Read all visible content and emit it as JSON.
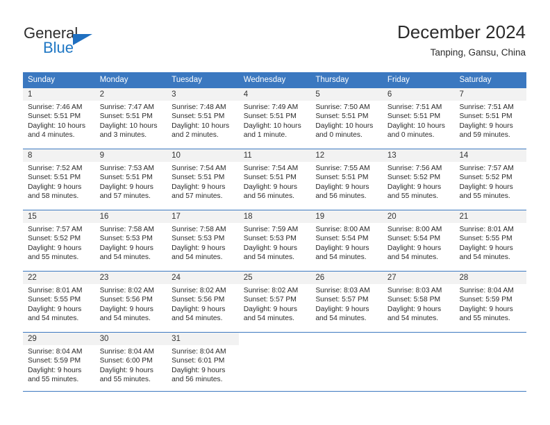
{
  "logo": {
    "line1": "General",
    "line2": "Blue",
    "triangle_icon": "triangle-icon"
  },
  "header": {
    "month_title": "December 2024",
    "location": "Tanping, Gansu, China"
  },
  "colors": {
    "header_blue": "#3b78c0",
    "logo_blue": "#1f77c4",
    "day_band": "#f2f2f2",
    "text": "#2a2a2a"
  },
  "calendar": {
    "weekday_headers": [
      "Sunday",
      "Monday",
      "Tuesday",
      "Wednesday",
      "Thursday",
      "Friday",
      "Saturday"
    ],
    "weeks": [
      [
        {
          "day": "1",
          "sunrise": "Sunrise: 7:46 AM",
          "sunset": "Sunset: 5:51 PM",
          "daylight1": "Daylight: 10 hours",
          "daylight2": "and 4 minutes."
        },
        {
          "day": "2",
          "sunrise": "Sunrise: 7:47 AM",
          "sunset": "Sunset: 5:51 PM",
          "daylight1": "Daylight: 10 hours",
          "daylight2": "and 3 minutes."
        },
        {
          "day": "3",
          "sunrise": "Sunrise: 7:48 AM",
          "sunset": "Sunset: 5:51 PM",
          "daylight1": "Daylight: 10 hours",
          "daylight2": "and 2 minutes."
        },
        {
          "day": "4",
          "sunrise": "Sunrise: 7:49 AM",
          "sunset": "Sunset: 5:51 PM",
          "daylight1": "Daylight: 10 hours",
          "daylight2": "and 1 minute."
        },
        {
          "day": "5",
          "sunrise": "Sunrise: 7:50 AM",
          "sunset": "Sunset: 5:51 PM",
          "daylight1": "Daylight: 10 hours",
          "daylight2": "and 0 minutes."
        },
        {
          "day": "6",
          "sunrise": "Sunrise: 7:51 AM",
          "sunset": "Sunset: 5:51 PM",
          "daylight1": "Daylight: 10 hours",
          "daylight2": "and 0 minutes."
        },
        {
          "day": "7",
          "sunrise": "Sunrise: 7:51 AM",
          "sunset": "Sunset: 5:51 PM",
          "daylight1": "Daylight: 9 hours",
          "daylight2": "and 59 minutes."
        }
      ],
      [
        {
          "day": "8",
          "sunrise": "Sunrise: 7:52 AM",
          "sunset": "Sunset: 5:51 PM",
          "daylight1": "Daylight: 9 hours",
          "daylight2": "and 58 minutes."
        },
        {
          "day": "9",
          "sunrise": "Sunrise: 7:53 AM",
          "sunset": "Sunset: 5:51 PM",
          "daylight1": "Daylight: 9 hours",
          "daylight2": "and 57 minutes."
        },
        {
          "day": "10",
          "sunrise": "Sunrise: 7:54 AM",
          "sunset": "Sunset: 5:51 PM",
          "daylight1": "Daylight: 9 hours",
          "daylight2": "and 57 minutes."
        },
        {
          "day": "11",
          "sunrise": "Sunrise: 7:54 AM",
          "sunset": "Sunset: 5:51 PM",
          "daylight1": "Daylight: 9 hours",
          "daylight2": "and 56 minutes."
        },
        {
          "day": "12",
          "sunrise": "Sunrise: 7:55 AM",
          "sunset": "Sunset: 5:51 PM",
          "daylight1": "Daylight: 9 hours",
          "daylight2": "and 56 minutes."
        },
        {
          "day": "13",
          "sunrise": "Sunrise: 7:56 AM",
          "sunset": "Sunset: 5:52 PM",
          "daylight1": "Daylight: 9 hours",
          "daylight2": "and 55 minutes."
        },
        {
          "day": "14",
          "sunrise": "Sunrise: 7:57 AM",
          "sunset": "Sunset: 5:52 PM",
          "daylight1": "Daylight: 9 hours",
          "daylight2": "and 55 minutes."
        }
      ],
      [
        {
          "day": "15",
          "sunrise": "Sunrise: 7:57 AM",
          "sunset": "Sunset: 5:52 PM",
          "daylight1": "Daylight: 9 hours",
          "daylight2": "and 55 minutes."
        },
        {
          "day": "16",
          "sunrise": "Sunrise: 7:58 AM",
          "sunset": "Sunset: 5:53 PM",
          "daylight1": "Daylight: 9 hours",
          "daylight2": "and 54 minutes."
        },
        {
          "day": "17",
          "sunrise": "Sunrise: 7:58 AM",
          "sunset": "Sunset: 5:53 PM",
          "daylight1": "Daylight: 9 hours",
          "daylight2": "and 54 minutes."
        },
        {
          "day": "18",
          "sunrise": "Sunrise: 7:59 AM",
          "sunset": "Sunset: 5:53 PM",
          "daylight1": "Daylight: 9 hours",
          "daylight2": "and 54 minutes."
        },
        {
          "day": "19",
          "sunrise": "Sunrise: 8:00 AM",
          "sunset": "Sunset: 5:54 PM",
          "daylight1": "Daylight: 9 hours",
          "daylight2": "and 54 minutes."
        },
        {
          "day": "20",
          "sunrise": "Sunrise: 8:00 AM",
          "sunset": "Sunset: 5:54 PM",
          "daylight1": "Daylight: 9 hours",
          "daylight2": "and 54 minutes."
        },
        {
          "day": "21",
          "sunrise": "Sunrise: 8:01 AM",
          "sunset": "Sunset: 5:55 PM",
          "daylight1": "Daylight: 9 hours",
          "daylight2": "and 54 minutes."
        }
      ],
      [
        {
          "day": "22",
          "sunrise": "Sunrise: 8:01 AM",
          "sunset": "Sunset: 5:55 PM",
          "daylight1": "Daylight: 9 hours",
          "daylight2": "and 54 minutes."
        },
        {
          "day": "23",
          "sunrise": "Sunrise: 8:02 AM",
          "sunset": "Sunset: 5:56 PM",
          "daylight1": "Daylight: 9 hours",
          "daylight2": "and 54 minutes."
        },
        {
          "day": "24",
          "sunrise": "Sunrise: 8:02 AM",
          "sunset": "Sunset: 5:56 PM",
          "daylight1": "Daylight: 9 hours",
          "daylight2": "and 54 minutes."
        },
        {
          "day": "25",
          "sunrise": "Sunrise: 8:02 AM",
          "sunset": "Sunset: 5:57 PM",
          "daylight1": "Daylight: 9 hours",
          "daylight2": "and 54 minutes."
        },
        {
          "day": "26",
          "sunrise": "Sunrise: 8:03 AM",
          "sunset": "Sunset: 5:57 PM",
          "daylight1": "Daylight: 9 hours",
          "daylight2": "and 54 minutes."
        },
        {
          "day": "27",
          "sunrise": "Sunrise: 8:03 AM",
          "sunset": "Sunset: 5:58 PM",
          "daylight1": "Daylight: 9 hours",
          "daylight2": "and 54 minutes."
        },
        {
          "day": "28",
          "sunrise": "Sunrise: 8:04 AM",
          "sunset": "Sunset: 5:59 PM",
          "daylight1": "Daylight: 9 hours",
          "daylight2": "and 55 minutes."
        }
      ],
      [
        {
          "day": "29",
          "sunrise": "Sunrise: 8:04 AM",
          "sunset": "Sunset: 5:59 PM",
          "daylight1": "Daylight: 9 hours",
          "daylight2": "and 55 minutes."
        },
        {
          "day": "30",
          "sunrise": "Sunrise: 8:04 AM",
          "sunset": "Sunset: 6:00 PM",
          "daylight1": "Daylight: 9 hours",
          "daylight2": "and 55 minutes."
        },
        {
          "day": "31",
          "sunrise": "Sunrise: 8:04 AM",
          "sunset": "Sunset: 6:01 PM",
          "daylight1": "Daylight: 9 hours",
          "daylight2": "and 56 minutes."
        },
        {
          "day": "",
          "sunrise": "",
          "sunset": "",
          "daylight1": "",
          "daylight2": ""
        },
        {
          "day": "",
          "sunrise": "",
          "sunset": "",
          "daylight1": "",
          "daylight2": ""
        },
        {
          "day": "",
          "sunrise": "",
          "sunset": "",
          "daylight1": "",
          "daylight2": ""
        },
        {
          "day": "",
          "sunrise": "",
          "sunset": "",
          "daylight1": "",
          "daylight2": ""
        }
      ]
    ]
  }
}
